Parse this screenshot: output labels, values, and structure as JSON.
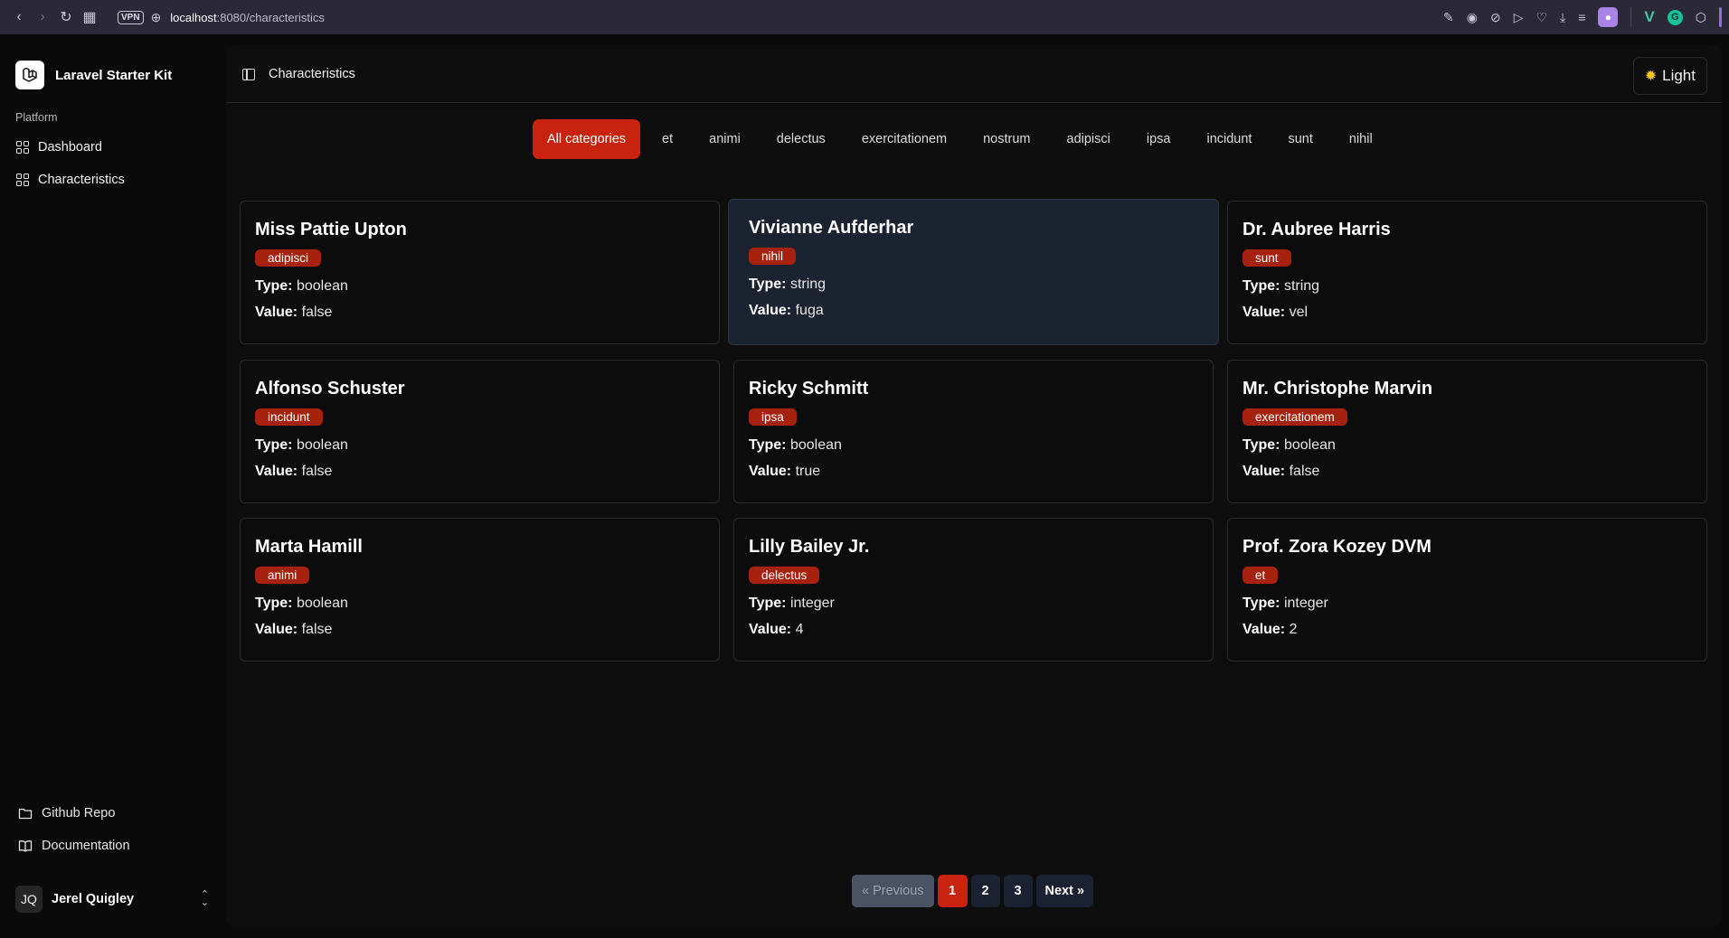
{
  "browser": {
    "url_host": "localhost",
    "url_path": ":8080/characteristics",
    "vpn_label": "VPN"
  },
  "sidebar": {
    "app_name": "Laravel Starter Kit",
    "section_label": "Platform",
    "nav": [
      {
        "label": "Dashboard"
      },
      {
        "label": "Characteristics"
      }
    ],
    "footer": [
      {
        "label": "Github Repo"
      },
      {
        "label": "Documentation"
      }
    ],
    "user": {
      "initials": "JQ",
      "name": "Jerel Quigley"
    }
  },
  "header": {
    "title": "Characteristics",
    "theme_label": "Light"
  },
  "categories": [
    "All categories",
    "et",
    "animi",
    "delectus",
    "exercitationem",
    "nostrum",
    "adipisci",
    "ipsa",
    "incidunt",
    "sunt",
    "nihil"
  ],
  "labels": {
    "type": "Type:",
    "value": "Value:"
  },
  "cards": [
    {
      "name": "Miss Pattie Upton",
      "category": "adipisci",
      "type": "boolean",
      "value": "false"
    },
    {
      "name": "Vivianne Aufderhar",
      "category": "nihil",
      "type": "string",
      "value": "fuga"
    },
    {
      "name": "Dr. Aubree Harris",
      "category": "sunt",
      "type": "string",
      "value": "vel"
    },
    {
      "name": "Alfonso Schuster",
      "category": "incidunt",
      "type": "boolean",
      "value": "false"
    },
    {
      "name": "Ricky Schmitt",
      "category": "ipsa",
      "type": "boolean",
      "value": "true"
    },
    {
      "name": "Mr. Christophe Marvin",
      "category": "exercitationem",
      "type": "boolean",
      "value": "false"
    },
    {
      "name": "Marta Hamill",
      "category": "animi",
      "type": "boolean",
      "value": "false"
    },
    {
      "name": "Lilly Bailey Jr.",
      "category": "delectus",
      "type": "integer",
      "value": "4"
    },
    {
      "name": "Prof. Zora Kozey DVM",
      "category": "et",
      "type": "integer",
      "value": "2"
    }
  ],
  "pagination": {
    "prev": "« Previous",
    "pages": [
      "1",
      "2",
      "3"
    ],
    "next": "Next »"
  }
}
